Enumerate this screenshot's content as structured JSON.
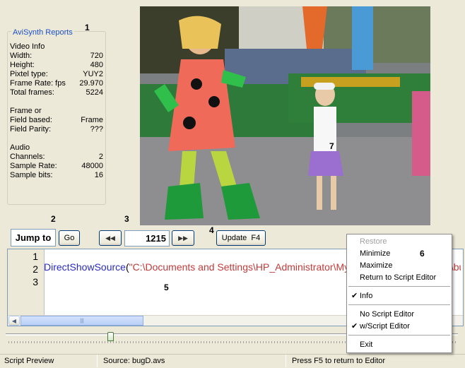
{
  "info": {
    "title": "AviSynth Reports",
    "video_heading": "Video Info",
    "rows": [
      {
        "label": "Width:",
        "value": "720"
      },
      {
        "label": "Height:",
        "value": "480"
      },
      {
        "label": "Pixtel type:",
        "value": "YUY2"
      },
      {
        "label": "Frame Rate: fps",
        "value": "29.970"
      },
      {
        "label": "Total frames:",
        "value": "5224"
      }
    ],
    "frame_heading": "Frame or",
    "field_rows": [
      {
        "label": "Field based:",
        "value": "Frame"
      },
      {
        "label": "Field Parity:",
        "value": "???"
      }
    ],
    "audio_heading": "Audio",
    "audio_rows": [
      {
        "label": "Channels:",
        "value": "2"
      },
      {
        "label": "Sample Rate:",
        "value": "48000"
      },
      {
        "label": "Sample bits:",
        "value": "16"
      }
    ]
  },
  "callouts": {
    "c1": "1",
    "c2": "2",
    "c3": "3",
    "c4": "4",
    "c5": "5",
    "c6": "6",
    "c7": "7"
  },
  "controls": {
    "jump_label": "Jump to",
    "go_label": "Go",
    "prev_label": "◀◀",
    "frame_value": "1215",
    "next_label": "▶▶",
    "update_label": "Update  F4"
  },
  "editor": {
    "line_numbers": [
      "1",
      "2",
      "3"
    ],
    "code_func": "DirectShowSource",
    "code_paren": "(",
    "code_string": "\"C:\\Documents and Settings\\HP_Administrator\\My Documents\\My Videos\\bugD.avi\")",
    "scroll_grip": "|||"
  },
  "timeline": {
    "position_fraction": 0.2326
  },
  "status": {
    "mode": "Script Preview",
    "source": "Source:  bugD.avs",
    "hint": "Press F5 to return to Editor"
  },
  "menu": {
    "restore": "Restore",
    "minimize": "Minimize",
    "maximize": "Maximize",
    "return": "Return to Script Editor",
    "info": "Info",
    "no_script": "No Script Editor",
    "with_script": "w/Script Editor",
    "exit": "Exit",
    "check": "✔"
  },
  "colors": {
    "accent_blue": "#1b4fc9",
    "keyword": "#2929c2",
    "string": "#c23a3a"
  }
}
